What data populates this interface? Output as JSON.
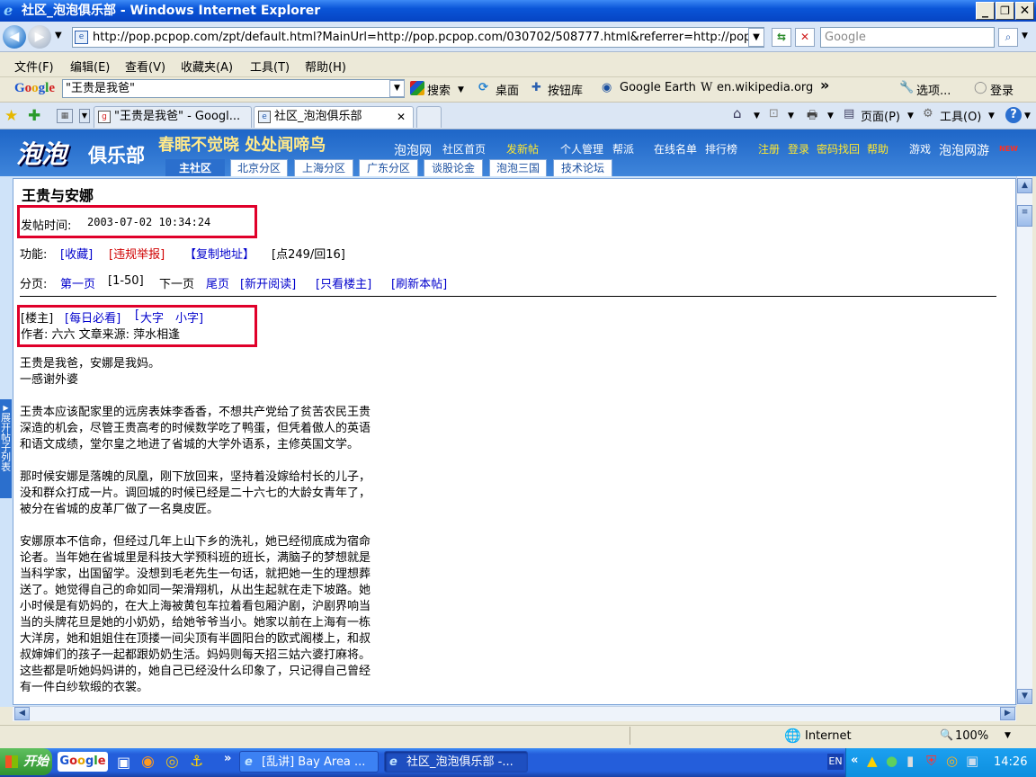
{
  "window": {
    "title": "社区_泡泡俱乐部 - Windows Internet Explorer",
    "min_label": "_",
    "max_label": "❐",
    "close_label": "✕"
  },
  "address": {
    "url": "http://pop.pcpop.com/zpt/default.html?MainUrl=http://pop.pcpop.com/030702/508777.html&referrer=http://pop.pcp",
    "search_placeholder": "Google",
    "back_label": "◀",
    "forward_label": "▶"
  },
  "menu": [
    "文件(F)",
    "编辑(E)",
    "查看(V)",
    "收藏夹(A)",
    "工具(T)",
    "帮助(H)"
  ],
  "google_toolbar": {
    "logo": "Google",
    "query": "\"王贵是我爸\"",
    "search": "搜索",
    "desktop": "桌面",
    "buttons_lib": "按钮库",
    "earth": "Google Earth",
    "wiki": "en.wikipedia.org",
    "more": "»",
    "options": "选项...",
    "login": "登录"
  },
  "tabs": [
    {
      "label": "\"王贵是我爸\" - Googl..."
    },
    {
      "label": "社区_泡泡俱乐部"
    }
  ],
  "tab_close": "✕",
  "commands": {
    "page": "页面(P)",
    "tools": "工具(O)",
    "help": "?"
  },
  "site_header": {
    "logo_a": "泡泡",
    "logo_b": "俱乐部",
    "slogan": "春眠不觉晓 处处闻啼鸟",
    "links": [
      "泡泡网",
      "社区首页",
      "发新帖",
      "个人管理",
      "帮派",
      "在线名单",
      "排行榜",
      "注册",
      "登录",
      "密码找回",
      "帮助",
      "游戏",
      "泡泡网游"
    ],
    "new_badge": "NEW",
    "forum_tabs": [
      "主社区",
      "北京分区",
      "上海分区",
      "广东分区",
      "谈股论金",
      "泡泡三国",
      "技术论坛"
    ]
  },
  "post": {
    "title": "王贵与安娜",
    "time_label": "发帖时间:",
    "time_value": "2003-07-02 10:34:24",
    "func_label": "功能:",
    "collect": "[收藏]",
    "report": "[违规举报]",
    "copy": "【复制地址】",
    "stats": "[点249/回16]",
    "paging_label": "分页:",
    "first": "第一页",
    "range": "[1-50]",
    "next": "下一页",
    "last": "尾页",
    "new_read": "[新开阅读]",
    "only_owner": "[只看楼主]",
    "refresh": "[刷新本帖]",
    "floor": "[楼主]",
    "daily": "[每日必看]",
    "font_open": "[",
    "big_font": "大字",
    "small_font": "小字]",
    "author_line": "作者: 六六 文章来源: 萍水相逢",
    "paragraphs": [
      [
        "王贵是我爸，安娜是我妈。",
        "一感谢外婆"
      ],
      [
        "王贵本应该配家里的远房表妹李香香，不想共产党给了贫苦农民王贵",
        "深造的机会，尽管王贵高考的时候数学吃了鸭蛋，但凭着傲人的英语",
        "和语文成绩，堂尔皇之地进了省城的大学外语系，主修英国文学。"
      ],
      [
        "那时候安娜是落魄的凤凰，刚下放回来，坚持着没嫁给村长的儿子，",
        "没和群众打成一片。调回城的时候已经是二十六七的大龄女青年了，",
        "被分在省城的皮革厂做了一名臭皮匠。"
      ],
      [
        "安娜原本不信命，但经过几年上山下乡的洗礼，她已经彻底成为宿命",
        "论者。当年她在省城里是科技大学预科班的班长，满脑子的梦想就是",
        "当科学家，出国留学。没想到毛老先生一句话，就把她一生的理想葬",
        "送了。她觉得自己的命如同一架滑翔机，从出生起就在走下坡路。她",
        "小时候是有奶妈的，在大上海被黄包车拉着看包厢沪剧，沪剧界响当",
        "当的头牌花旦是她的小奶奶，给她爷爷当小。她家以前在上海有一栋",
        "大洋房，她和姐姐住在顶搂一间尖顶有半圆阳台的欧式阁楼上，和叔",
        "叔婶婶们的孩子一起都跟奶奶生活。妈妈则每天招三姑六婆打麻将。",
        "这些都是听她妈妈讲的，她自己已经没什么印象了，只记得自己曾经",
        "有一件白纱软缎的衣裳。"
      ]
    ],
    "side_tab": "展开帖子列表"
  },
  "status": {
    "zone": "Internet",
    "zoom": "100%"
  },
  "taskbar": {
    "start": "开始",
    "items": [
      "[乱讲] Bay Area ...",
      "社区_泡泡俱乐部 -..."
    ],
    "lang": "EN",
    "clock": "14:26"
  }
}
